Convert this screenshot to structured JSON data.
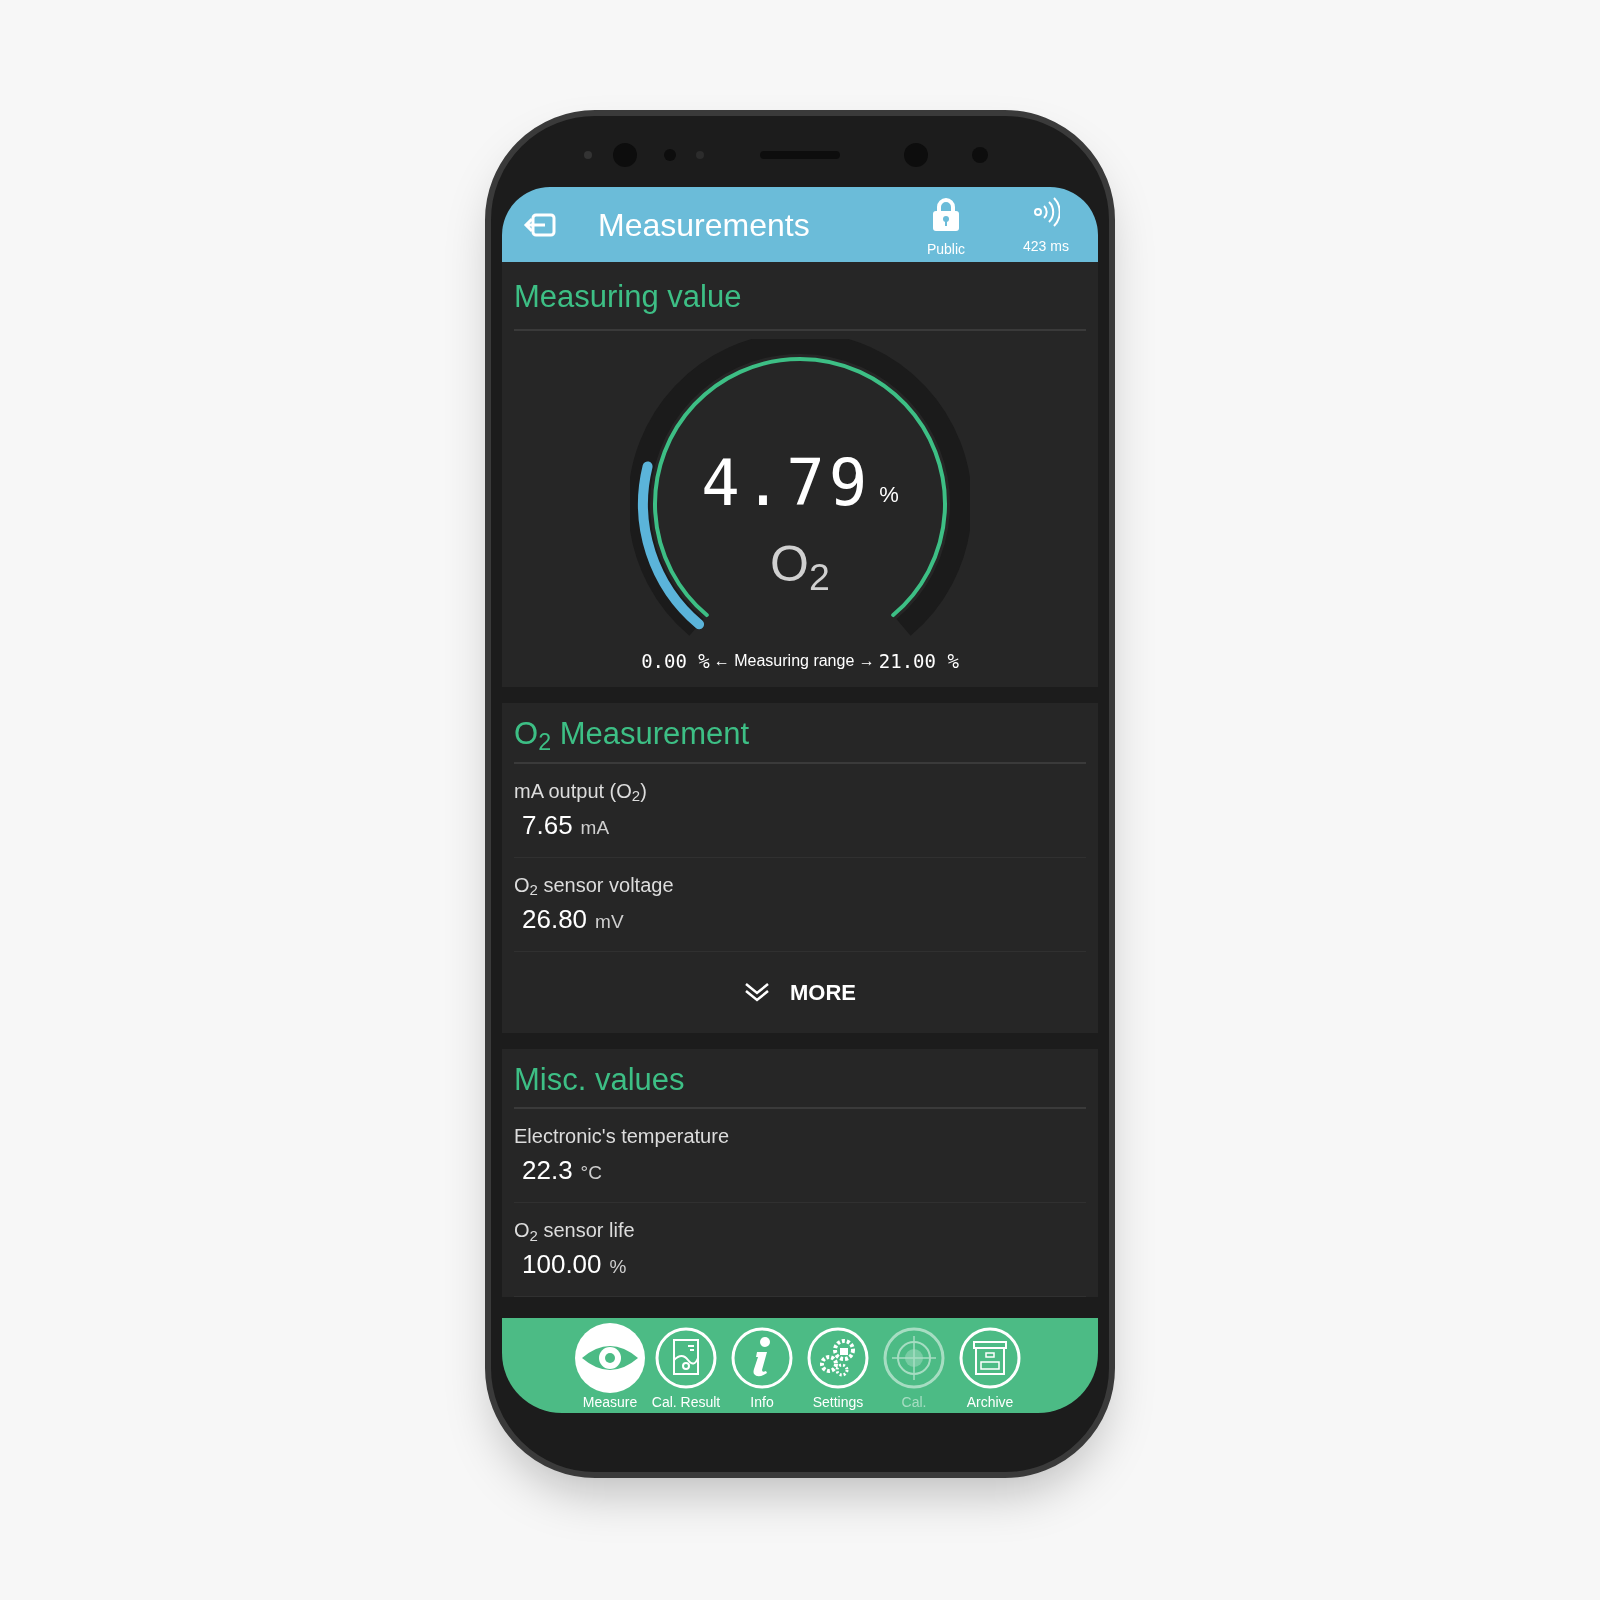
{
  "header": {
    "title": "Measurements",
    "access": "Public",
    "latency": "423 ms"
  },
  "gauge_card": {
    "title": "Measuring value",
    "value": "4.79",
    "unit": "%",
    "gas": "O$_{2}$",
    "level": 0.228,
    "range_min": "0.00 %",
    "range_label": "← Measuring range →",
    "range_max": "21.00 %"
  },
  "sections": [
    {
      "title": "O$_{2}$ Measurement",
      "rows": [
        {
          "label": "mA output (O$_{2}$)",
          "value": "7.65",
          "unit": "mA"
        },
        {
          "label": "O$_{2}$ sensor voltage",
          "value": "26.80",
          "unit": "mV"
        }
      ],
      "more": "MORE"
    },
    {
      "title": "Misc. values",
      "rows": [
        {
          "label": "Electronic's temperature",
          "value": "22.3",
          "unit": "°C"
        },
        {
          "label": "O$_{2}$ sensor life",
          "value": "100.00",
          "unit": "%"
        }
      ]
    }
  ],
  "nav": [
    {
      "label": "Measure",
      "kind": "eye",
      "selected": true,
      "disabled": false
    },
    {
      "label": "Cal. Result",
      "kind": "report",
      "selected": false,
      "disabled": false
    },
    {
      "label": "Info",
      "kind": "info",
      "selected": false,
      "disabled": false
    },
    {
      "label": "Settings",
      "kind": "gears",
      "selected": false,
      "disabled": false
    },
    {
      "label": "Cal.",
      "kind": "target",
      "selected": false,
      "disabled": true
    },
    {
      "label": "Archive",
      "kind": "archive",
      "selected": false,
      "disabled": false
    }
  ]
}
